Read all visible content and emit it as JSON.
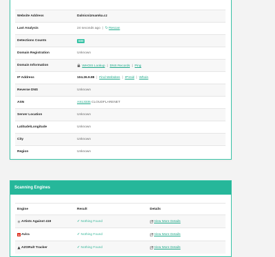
{
  "info": {
    "rows": [
      {
        "label": "Website Address",
        "value": "Dalnicnizmamka.cz"
      },
      {
        "label": "Last Analysis",
        "value": "24 seconds ago",
        "action": "Rescan"
      },
      {
        "label": "Detections Counts",
        "badge": "0/59"
      },
      {
        "label": "Domain Registration",
        "value": "Unknown"
      },
      {
        "label": "Domain Information",
        "links": [
          "WHOIS Lookup",
          "DNS Records",
          "Ping"
        ]
      },
      {
        "label": "IP Address",
        "value": "104.26.9.88",
        "links": [
          "Find Websites",
          "IPVoid",
          "Whois"
        ]
      },
      {
        "label": "Reverse DNS",
        "value": "Unknown"
      },
      {
        "label": "ASN",
        "link": "AS13335",
        "value": "CLOUDFLARENET"
      },
      {
        "label": "Server Location",
        "value": "Unknown"
      },
      {
        "label": "Latitude\\Longitude",
        "value": "Unknown"
      },
      {
        "label": "City",
        "value": "Unknown"
      },
      {
        "label": "Region",
        "value": "Unknown"
      }
    ]
  },
  "engines": {
    "title": "Scanning Engines",
    "headers": [
      "Engine",
      "Result",
      "Details"
    ],
    "rows": [
      {
        "name": "Artists Against 419",
        "icon": "artists-icon",
        "result": "Nothing Found",
        "details": "View More Details"
      },
      {
        "name": "Avira",
        "icon": "avira-icon",
        "result": "Nothing Found",
        "details": "View More Details"
      },
      {
        "name": "AZORult Tracker",
        "icon": "azorult-icon",
        "result": "Nothing Found",
        "details": "View More Details"
      }
    ]
  },
  "colors": {
    "accent": "#26b79a",
    "link": "#1aa888"
  }
}
